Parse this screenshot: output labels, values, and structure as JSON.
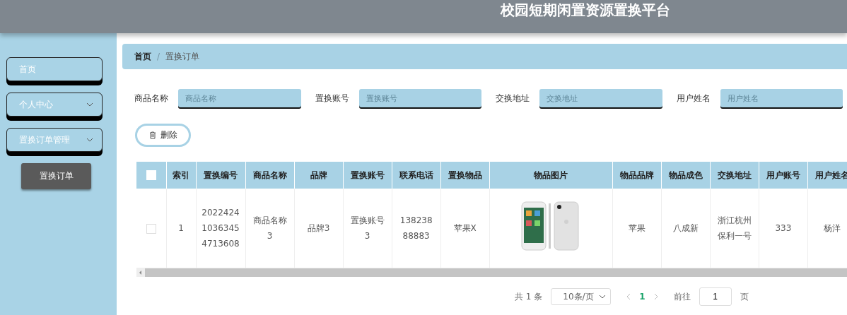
{
  "header": {
    "title": "校园短期闲置资源置换平台"
  },
  "sidebar": {
    "items": [
      {
        "label": "首页",
        "has_children": false
      },
      {
        "label": "个人中心",
        "has_children": true
      },
      {
        "label": "置换订单管理",
        "has_children": true,
        "children": [
          {
            "label": "置换订单",
            "selected": true
          }
        ]
      }
    ]
  },
  "breadcrumb": [
    "首页",
    "置换订单"
  ],
  "breadcrumb_separator": "/",
  "search": [
    {
      "label": "商品名称",
      "placeholder": "商品名称"
    },
    {
      "label": "置换账号",
      "placeholder": "置换账号"
    },
    {
      "label": "交换地址",
      "placeholder": "交换地址"
    },
    {
      "label": "用户姓名",
      "placeholder": "用户姓名"
    }
  ],
  "delete_button": {
    "label": "删除"
  },
  "table": {
    "columns": [
      "索引",
      "置换编号",
      "商品名称",
      "品牌",
      "置换账号",
      "联系电话",
      "置换物品",
      "物品图片",
      "物品品牌",
      "物品成色",
      "交换地址",
      "用户账号",
      "用户姓名"
    ],
    "select_all_checked": false,
    "rows": [
      {
        "checked": false,
        "cells": [
          "1",
          "202242410363454713608",
          "商品名称3",
          "品牌3",
          "置换账号3",
          "13823888883",
          "苹果X",
          {
            "kind": "picture"
          },
          "苹果",
          "八成新",
          "浙江杭州保利一号",
          "333",
          "杨洋"
        ]
      }
    ]
  },
  "pagination": {
    "total": "共 1 条",
    "page_size": "10条/页",
    "pages": [
      {
        "label": "1",
        "selected": true
      }
    ],
    "goto_label": "前往",
    "goto_value": "1",
    "page_suffix": "页"
  }
}
